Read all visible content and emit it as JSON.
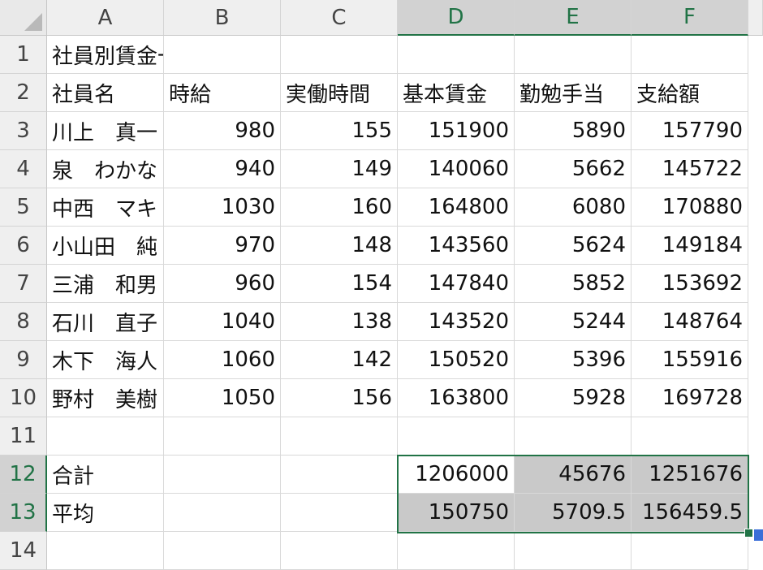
{
  "columns": [
    "A",
    "B",
    "C",
    "D",
    "E",
    "F"
  ],
  "rows": [
    "1",
    "2",
    "3",
    "4",
    "5",
    "6",
    "7",
    "8",
    "9",
    "10",
    "11",
    "12",
    "13",
    "14"
  ],
  "cells": {
    "title": "社員別賃金一覧表",
    "headers": [
      "社員名",
      "時給",
      "実働時間",
      "基本賃金",
      "勤勉手当",
      "支給額"
    ],
    "data": [
      [
        "川上　真一",
        "980",
        "155",
        "151900",
        "5890",
        "157790"
      ],
      [
        "泉　わかな",
        "940",
        "149",
        "140060",
        "5662",
        "145722"
      ],
      [
        "中西　マキ",
        "1030",
        "160",
        "164800",
        "6080",
        "170880"
      ],
      [
        "小山田　純",
        "970",
        "148",
        "143560",
        "5624",
        "149184"
      ],
      [
        "三浦　和男",
        "960",
        "154",
        "147840",
        "5852",
        "153692"
      ],
      [
        "石川　直子",
        "1040",
        "138",
        "143520",
        "5244",
        "148764"
      ],
      [
        "木下　海人",
        "1060",
        "142",
        "150520",
        "5396",
        "155916"
      ],
      [
        "野村　美樹",
        "1050",
        "156",
        "163800",
        "5928",
        "169728"
      ]
    ],
    "total": {
      "label": "合計",
      "D": "1206000",
      "E": "45676",
      "F": "1251676"
    },
    "average": {
      "label": "平均",
      "D": "150750",
      "E": "5709.5",
      "F": "156459.5"
    }
  },
  "colors": {
    "accent": "#217346",
    "selection_fill": "#c9c9c9"
  }
}
